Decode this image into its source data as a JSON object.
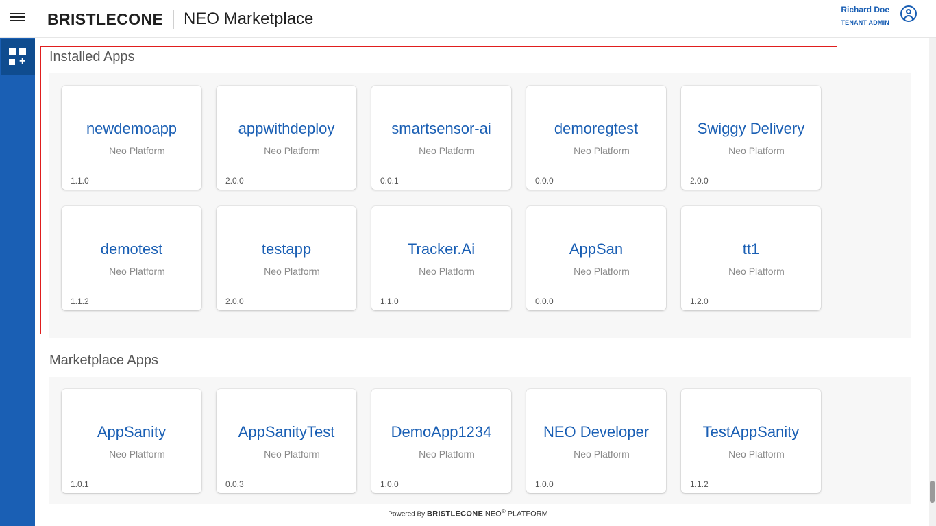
{
  "header": {
    "logo": "BRISTLECONE",
    "title": "NEO Marketplace",
    "user_name": "Richard Doe",
    "user_role": "TENANT ADMIN"
  },
  "installed": {
    "title": "Installed Apps",
    "apps": [
      {
        "name": "newdemoapp",
        "vendor": "Neo Platform",
        "version": "1.1.0"
      },
      {
        "name": "appwithdeploy",
        "vendor": "Neo Platform",
        "version": "2.0.0"
      },
      {
        "name": "smartsensor-ai",
        "vendor": "Neo Platform",
        "version": "0.0.1"
      },
      {
        "name": "demoregtest",
        "vendor": "Neo Platform",
        "version": "0.0.0"
      },
      {
        "name": "Swiggy Delivery",
        "vendor": "Neo Platform",
        "version": "2.0.0"
      },
      {
        "name": "demotest",
        "vendor": "Neo Platform",
        "version": "1.1.2"
      },
      {
        "name": "testapp",
        "vendor": "Neo Platform",
        "version": "2.0.0"
      },
      {
        "name": "Tracker.Ai",
        "vendor": "Neo Platform",
        "version": "1.1.0"
      },
      {
        "name": "AppSan",
        "vendor": "Neo Platform",
        "version": "0.0.0"
      },
      {
        "name": "tt1",
        "vendor": "Neo Platform",
        "version": "1.2.0"
      }
    ]
  },
  "marketplace": {
    "title": "Marketplace Apps",
    "apps": [
      {
        "name": "AppSanity",
        "vendor": "Neo Platform",
        "version": "1.0.1"
      },
      {
        "name": "AppSanityTest",
        "vendor": "Neo Platform",
        "version": "0.0.3"
      },
      {
        "name": "DemoApp1234",
        "vendor": "Neo Platform",
        "version": "1.0.0"
      },
      {
        "name": "NEO Developer",
        "vendor": "Neo Platform",
        "version": "1.0.0"
      },
      {
        "name": "TestAppSanity",
        "vendor": "Neo Platform",
        "version": "1.1.2"
      }
    ]
  },
  "footer": {
    "powered_by": "Powered By",
    "brand": "BRISTLECONE",
    "neo": "NEO",
    "reg": "®",
    "platform": "PLATFORM"
  },
  "colors": {
    "accent": "#1a5fb4",
    "highlight": "#e01e1e"
  },
  "icons": {
    "menu": "hamburger-menu-icon",
    "user": "user-circle-icon",
    "apps": "app-grid-add-icon"
  }
}
